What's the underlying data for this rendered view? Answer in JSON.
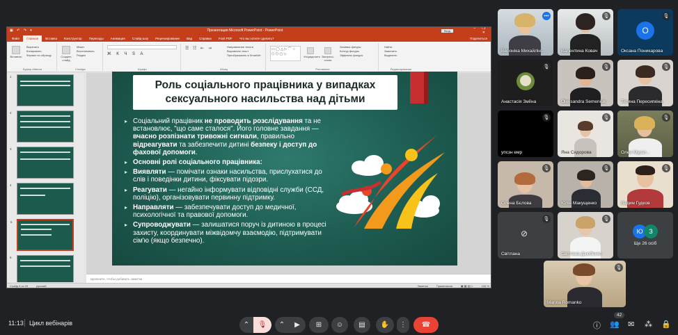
{
  "meeting": {
    "time": "11:13",
    "name": "Цикл вебінарів",
    "people_count": "42"
  },
  "ppt": {
    "window_title": "Презентация Microsoft PowerPoint - PowerPoint",
    "enter_button": "Вход",
    "tabs": [
      "Файл",
      "Главная",
      "Вставка",
      "Конструктор",
      "Переходы",
      "Анимация",
      "Слайд-шоу",
      "Рецензирование",
      "Вид",
      "Справка",
      "Foxit PDF",
      "Что вы хотите сделать?"
    ],
    "share_label": "Поделиться",
    "ribbon": {
      "clipboard": {
        "paste": "Вставить",
        "cut": "Вырезать",
        "copy": "Копировать",
        "format": "Формат по образцу",
        "group": "Буфер обмена"
      },
      "slides": {
        "new": "Создать слайд",
        "layout": "Макет",
        "reset": "Восстановить",
        "section": "Раздел",
        "group": "Слайды"
      },
      "font": {
        "group": "Шрифт"
      },
      "paragraph": {
        "direction": "Направление текста",
        "align": "Выровнять текст",
        "smartart": "Преобразовать в SmartArt",
        "group": "Абзац"
      },
      "drawing": {
        "arrange": "Упорядочить",
        "styles": "Экспресс-стили",
        "fill": "Заливка фигуры",
        "outline": "Контур фигуры",
        "effects": "Эффекты фигуры",
        "group": "Рисование"
      },
      "editing": {
        "find": "Найти",
        "replace": "Заменить",
        "select": "Выделить",
        "group": "Редактирование"
      }
    },
    "notes_placeholder": "Щелкните, чтобы добавить заметки",
    "status": {
      "slide": "Слайд 5 из 33",
      "lang": "русский",
      "notes": "Заметки",
      "comments": "Примечания",
      "zoom": "106 %"
    },
    "thumb_numbers": [
      "1",
      "2",
      "3",
      "4",
      "5",
      "6"
    ]
  },
  "slide": {
    "title_line1": "Роль соціального працівника у випадках",
    "title_line2": "сексуального насильства над дітьми",
    "p1_a": "Соціальний працівник ",
    "p1_b": "не проводить розслідування",
    "p1_c": " та не встановлює, \"що саме сталося\". Його головне завдання — ",
    "p1_d": "вчасно розпізнати тривожні сигнали",
    "p1_e": ", правильно ",
    "p1_f": "відреагувати",
    "p1_g": " та забезпечити дитині ",
    "p1_h": "безпеку і доступ до фахової допомоги",
    "p1_i": ".",
    "roles_heading": "Основні ролі соціального працівника:",
    "r1_b": "Виявляти",
    "r1_t": " — помічати ознаки насильства, прислухатися до слів і поведінки дитини, фіксувати підозри.",
    "r2_b": "Реагувати",
    "r2_t": " — негайно інформувати відповідні служби (ССД, поліцію), організовувати первинну підтримку.",
    "r3_b": "Направляти",
    "r3_t": " — забезпечувати доступ до медичної, психологічної та правової допомоги.",
    "r4_b": "Супроводжувати",
    "r4_t": " — залишатися поруч із дитиною в процесі захисту, координувати міжвідомчу взаємодію, підтримувати сім'ю (якщо безпечно)."
  },
  "participants": [
    {
      "name": "Вероніка Михайлін..."
    },
    {
      "name": "Валентина Ковач"
    },
    {
      "name": "Оксана Поникарова",
      "initial": "О"
    },
    {
      "name": "Анастасія Зміїна"
    },
    {
      "name": "Oleksandra Semeniuk"
    },
    {
      "name": "Тетяна Пересипкіна"
    },
    {
      "name": "упсзн емр"
    },
    {
      "name": "Яна Сидорова"
    },
    {
      "name": "Олен Мурат..."
    },
    {
      "name": "Олена Бєлова"
    },
    {
      "name": "Юлія Макущенко"
    },
    {
      "name": "Вадим Гудков"
    },
    {
      "name": "Світлана"
    },
    {
      "name": "Світлана Дзюбенко"
    },
    {
      "name": "Ще 26 осіб",
      "i1": "Ю",
      "i2": "З"
    },
    {
      "name": "Marina Romanko"
    }
  ]
}
